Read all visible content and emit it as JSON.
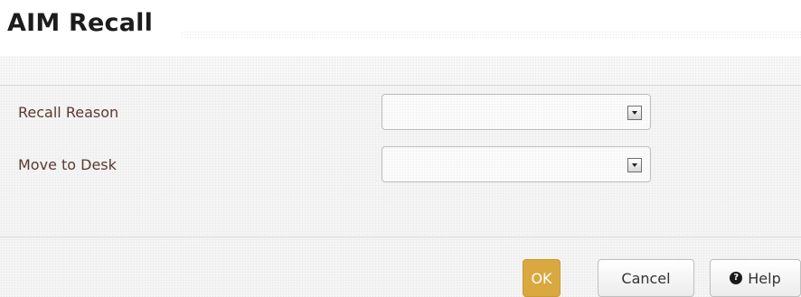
{
  "dialog": {
    "title": "AIM Recall"
  },
  "form": {
    "recall_reason": {
      "label": "Recall Reason",
      "value": ""
    },
    "move_to_desk": {
      "label": "Move to Desk",
      "value": ""
    }
  },
  "footer": {
    "ok_label": "OK",
    "cancel_label": "Cancel",
    "help_label": "Help",
    "help_icon": "question-circle-icon"
  }
}
